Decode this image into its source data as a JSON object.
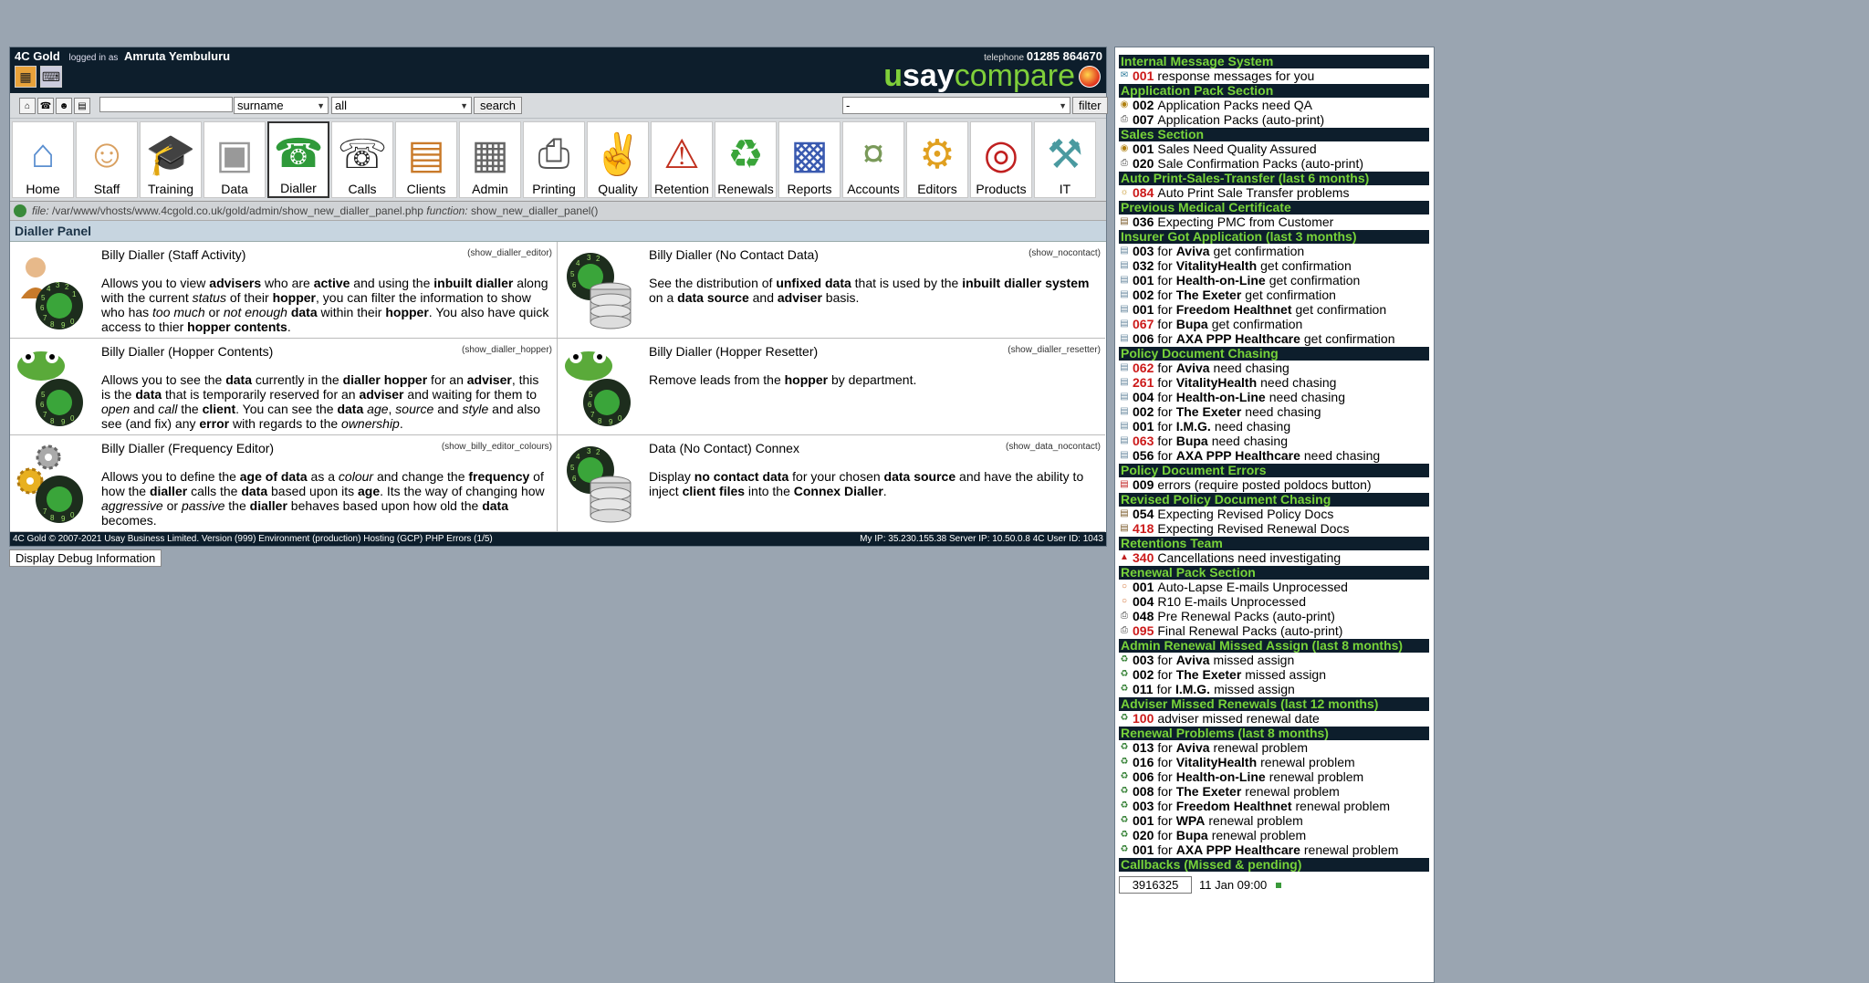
{
  "topbar": {
    "brand": "4C Gold",
    "logged_in_text": "logged in as",
    "user": "Amruta Yembuluru",
    "telephone_label": "telephone",
    "telephone_number": "01285 864670",
    "logo": {
      "u": "u",
      "say": "say",
      "compare": "compare"
    }
  },
  "search": {
    "field1_select": "surname",
    "field2_select": "all",
    "search_label": "search",
    "right_select": "-",
    "filter_label": "filter"
  },
  "nav": [
    {
      "label": "Home",
      "icon": "house-icon"
    },
    {
      "label": "Staff",
      "icon": "people-icon"
    },
    {
      "label": "Training",
      "icon": "graduation-cap-icon"
    },
    {
      "label": "Data",
      "icon": "database-icon"
    },
    {
      "label": "Dialler",
      "icon": "rotary-dial-icon",
      "active": true
    },
    {
      "label": "Calls",
      "icon": "telephone-icon"
    },
    {
      "label": "Clients",
      "icon": "filing-cabinet-icon"
    },
    {
      "label": "Admin",
      "icon": "document-icon"
    },
    {
      "label": "Printing",
      "icon": "printer-icon"
    },
    {
      "label": "Quality",
      "icon": "thumbs-up-icon"
    },
    {
      "label": "Retention",
      "icon": "alert-cabinet-icon"
    },
    {
      "label": "Renewals",
      "icon": "recycle-icon"
    },
    {
      "label": "Reports",
      "icon": "bar-chart-icon"
    },
    {
      "label": "Accounts",
      "icon": "money-icon"
    },
    {
      "label": "Editors",
      "icon": "gears-icon"
    },
    {
      "label": "Products",
      "icon": "target-icon"
    },
    {
      "label": "IT",
      "icon": "tools-icon"
    }
  ],
  "filebar": {
    "file_label": "file:",
    "file_path": "/var/www/vhosts/www.4cgold.co.uk/gold/admin/show_new_dialler_panel.php",
    "function_label": "function:",
    "function_name": "show_new_dialler_panel()"
  },
  "panel_title": "Dialler Panel",
  "cells": [
    {
      "title": "Billy Dialler (Staff Activity)",
      "fn": "(show_dialler_editor)"
    },
    {
      "title": "Billy Dialler (No Contact Data)",
      "fn": "(show_nocontact)"
    },
    {
      "title": "Billy Dialler (Hopper Contents)",
      "fn": "(show_dialler_hopper)"
    },
    {
      "title": "Billy Dialler (Hopper Resetter)",
      "fn": "(show_dialler_resetter)"
    },
    {
      "title": "Billy Dialler (Frequency Editor)",
      "fn": "(show_billy_editor_colours)"
    },
    {
      "title": "Data (No Contact) Connex",
      "fn": "(show_data_nocontact)"
    }
  ],
  "footer": {
    "left": "4C Gold © 2007-2021 Usay Business Limited. Version (999) Environment (production) Hosting (GCP) PHP Errors (1/5)",
    "right": "My IP: 35.230.155.38 Server IP: 10.50.0.8 4C User ID: 1043"
  },
  "debug_button": "Display Debug Information",
  "sidebar": [
    {
      "head": "Internal Message System",
      "items": [
        {
          "c": "001",
          "red": true,
          "text": "response messages for you",
          "icon": "message-icon"
        }
      ]
    },
    {
      "head": "Application Pack Section",
      "items": [
        {
          "c": "002",
          "text": "Application Packs need QA",
          "icon": "qa-icon"
        },
        {
          "c": "007",
          "text": "Application Packs (auto-print)",
          "icon": "printer-icon"
        }
      ]
    },
    {
      "head": "Sales Section",
      "items": [
        {
          "c": "001",
          "text": "Sales Need Quality Assured",
          "icon": "qa-icon"
        },
        {
          "c": "020",
          "text": "Sale Confirmation Packs (auto-print)",
          "icon": "printer-icon"
        }
      ]
    },
    {
      "head": "Auto Print-Sales-Transfer (last 6 months)",
      "items": [
        {
          "c": "084",
          "red": true,
          "text": "Auto Print Sale Transfer problems",
          "icon": "warning-icon"
        }
      ]
    },
    {
      "head": "Previous Medical Certificate",
      "items": [
        {
          "c": "036",
          "text": "Expecting PMC from Customer",
          "icon": "doc-icon"
        }
      ]
    },
    {
      "head": "Insurer Got Application (last 3 months)",
      "items": [
        {
          "c": "003",
          "pre": "for",
          "ins": "Aviva",
          "text": "get confirmation",
          "icon": "list-icon"
        },
        {
          "c": "032",
          "pre": "for",
          "ins": "VitalityHealth",
          "text": "get confirmation",
          "icon": "list-icon"
        },
        {
          "c": "001",
          "pre": "for",
          "ins": "Health-on-Line",
          "text": "get confirmation",
          "icon": "list-icon"
        },
        {
          "c": "002",
          "pre": "for",
          "ins": "The Exeter",
          "text": "get confirmation",
          "icon": "list-icon"
        },
        {
          "c": "001",
          "pre": "for",
          "ins": "Freedom Healthnet",
          "text": "get confirmation",
          "icon": "list-icon"
        },
        {
          "c": "067",
          "red": true,
          "pre": "for",
          "ins": "Bupa",
          "text": "get confirmation",
          "icon": "list-icon"
        },
        {
          "c": "006",
          "pre": "for",
          "ins": "AXA PPP Healthcare",
          "text": "get confirmation",
          "icon": "list-icon"
        }
      ]
    },
    {
      "head": "Policy Document Chasing",
      "items": [
        {
          "c": "062",
          "red": true,
          "pre": "for",
          "ins": "Aviva",
          "text": "need chasing",
          "icon": "list-icon"
        },
        {
          "c": "261",
          "red": true,
          "pre": "for",
          "ins": "VitalityHealth",
          "text": "need chasing",
          "icon": "list-icon"
        },
        {
          "c": "004",
          "pre": "for",
          "ins": "Health-on-Line",
          "text": "need chasing",
          "icon": "list-icon"
        },
        {
          "c": "002",
          "pre": "for",
          "ins": "The Exeter",
          "text": "need chasing",
          "icon": "list-icon"
        },
        {
          "c": "001",
          "pre": "for",
          "ins": "I.M.G.",
          "text": "need chasing",
          "icon": "list-icon"
        },
        {
          "c": "063",
          "red": true,
          "pre": "for",
          "ins": "Bupa",
          "text": "need chasing",
          "icon": "list-icon"
        },
        {
          "c": "056",
          "pre": "for",
          "ins": "AXA PPP Healthcare",
          "text": "need chasing",
          "icon": "list-icon"
        }
      ]
    },
    {
      "head": "Policy Document Errors",
      "items": [
        {
          "c": "009",
          "text": "errors (require posted poldocs button)",
          "icon": "error-doc-icon"
        }
      ]
    },
    {
      "head": "Revised Policy Document Chasing",
      "items": [
        {
          "c": "054",
          "text": "Expecting Revised Policy Docs",
          "icon": "doc-icon"
        },
        {
          "c": "418",
          "red": true,
          "text": "Expecting Revised Renewal Docs",
          "icon": "doc-icon"
        }
      ]
    },
    {
      "head": "Retentions Team",
      "items": [
        {
          "c": "340",
          "red": true,
          "text": "Cancellations need investigating",
          "icon": "alert-icon"
        }
      ]
    },
    {
      "head": "Renewal Pack Section",
      "items": [
        {
          "c": "001",
          "text": "Auto-Lapse E-mails Unprocessed",
          "icon": "email-icon"
        },
        {
          "c": "004",
          "text": "R10 E-mails Unprocessed",
          "icon": "email-icon"
        },
        {
          "c": "048",
          "text": "Pre Renewal Packs (auto-print)",
          "icon": "printer-icon"
        },
        {
          "c": "095",
          "red": true,
          "text": "Final Renewal Packs (auto-print)",
          "icon": "printer-icon"
        }
      ]
    },
    {
      "head": "Admin Renewal Missed Assign (last 8 months)",
      "items": [
        {
          "c": "003",
          "pre": "for",
          "ins": "Aviva",
          "text": "missed assign",
          "icon": "recycle-icon"
        },
        {
          "c": "002",
          "pre": "for",
          "ins": "The Exeter",
          "text": "missed assign",
          "icon": "recycle-icon"
        },
        {
          "c": "011",
          "pre": "for",
          "ins": "I.M.G.",
          "text": "missed assign",
          "icon": "recycle-icon"
        }
      ]
    },
    {
      "head": "Adviser Missed Renewals (last 12 months)",
      "items": [
        {
          "c": "100",
          "red": true,
          "text": "adviser missed renewal date",
          "icon": "recycle-icon"
        }
      ]
    },
    {
      "head": "Renewal Problems (last 8 months)",
      "items": [
        {
          "c": "013",
          "pre": "for",
          "ins": "Aviva",
          "text": "renewal problem",
          "icon": "recycle-icon"
        },
        {
          "c": "016",
          "pre": "for",
          "ins": "VitalityHealth",
          "text": "renewal problem",
          "icon": "recycle-icon"
        },
        {
          "c": "006",
          "pre": "for",
          "ins": "Health-on-Line",
          "text": "renewal problem",
          "icon": "recycle-icon"
        },
        {
          "c": "008",
          "pre": "for",
          "ins": "The Exeter",
          "text": "renewal problem",
          "icon": "recycle-icon"
        },
        {
          "c": "003",
          "pre": "for",
          "ins": "Freedom Healthnet",
          "text": "renewal problem",
          "icon": "recycle-icon"
        },
        {
          "c": "001",
          "pre": "for",
          "ins": "WPA",
          "text": "renewal problem",
          "icon": "recycle-icon"
        },
        {
          "c": "020",
          "pre": "for",
          "ins": "Bupa",
          "text": "renewal problem",
          "icon": "recycle-icon"
        },
        {
          "c": "001",
          "pre": "for",
          "ins": "AXA PPP Healthcare",
          "text": "renewal problem",
          "icon": "recycle-icon"
        }
      ]
    },
    {
      "head": "Callbacks (Missed & pending)",
      "items": []
    }
  ],
  "callback": {
    "id": "3916325",
    "when": "11 Jan 09:00"
  },
  "colors": {
    "dark_bar": "#0d1e2c",
    "green_accent": "#77d33a",
    "red_count": "#cc1a1a"
  }
}
